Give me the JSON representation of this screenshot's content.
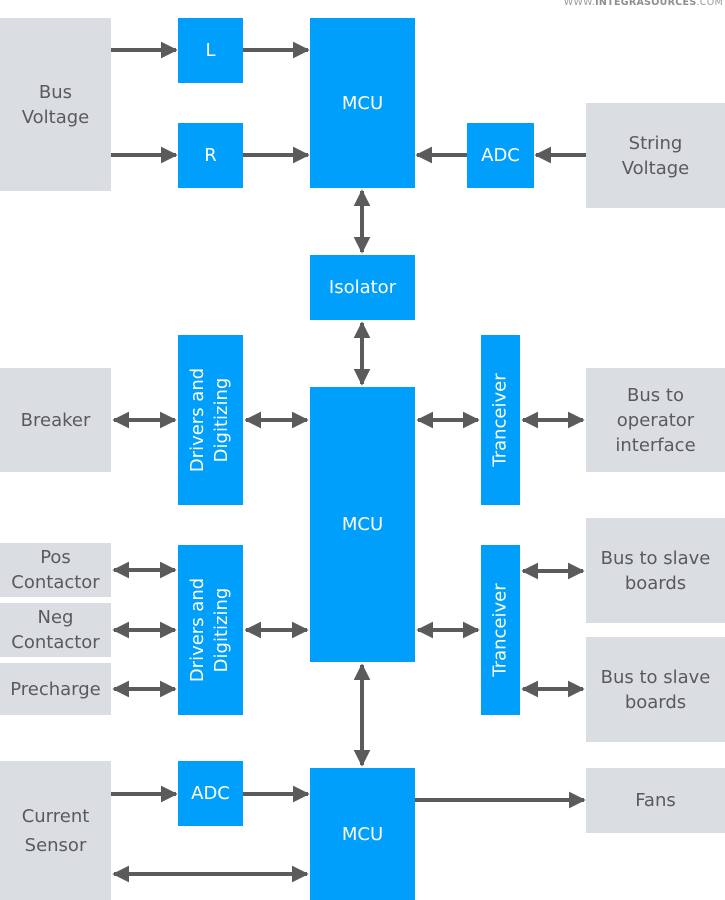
{
  "watermark": {
    "prefix": "WWW.",
    "brand": "INTEGRASOURCES",
    "suffix": ".COM"
  },
  "colors": {
    "block": "#009ffb",
    "external": "#dadde2",
    "arrow": "#5b5b5e",
    "external_text": "#5a5a5c"
  },
  "blocks": {
    "bus_voltage": "Bus\nVoltage",
    "l": "L",
    "r": "R",
    "mcu_top": "MCU",
    "adc_top": "ADC",
    "string_voltage": "String\nVoltage",
    "isolator": "Isolator",
    "breaker": "Breaker",
    "drivers_1": "Drivers and\nDigitizing",
    "mcu_main": "MCU",
    "tranceiver_1": "Tranceiver",
    "bus_operator": "Bus to\noperator\ninterface",
    "pos_contactor": "Pos\nContactor",
    "neg_contactor": "Neg\nContactor",
    "precharge": "Precharge",
    "drivers_2": "Drivers and\nDigitizing",
    "tranceiver_2": "Tranceiver",
    "bus_slave_1": "Bus to slave\nboards",
    "bus_slave_2": "Bus to slave\nboards",
    "current_sensor": "Current\nSensor",
    "adc_bottom": "ADC",
    "mcu_bottom": "MCU",
    "fans": "Fans"
  },
  "connections": [
    {
      "from": "Bus Voltage",
      "to": "L",
      "direction": "forward"
    },
    {
      "from": "Bus Voltage",
      "to": "R",
      "direction": "forward"
    },
    {
      "from": "L",
      "to": "MCU (top)",
      "direction": "forward"
    },
    {
      "from": "R",
      "to": "MCU (top)",
      "direction": "forward"
    },
    {
      "from": "String Voltage",
      "to": "ADC (top)",
      "direction": "forward"
    },
    {
      "from": "ADC (top)",
      "to": "MCU (top)",
      "direction": "forward"
    },
    {
      "from": "MCU (top)",
      "to": "Isolator",
      "direction": "bidirectional"
    },
    {
      "from": "Isolator",
      "to": "MCU (main)",
      "direction": "bidirectional"
    },
    {
      "from": "Breaker",
      "to": "Drivers and Digitizing (1)",
      "direction": "bidirectional"
    },
    {
      "from": "Drivers and Digitizing (1)",
      "to": "MCU (main)",
      "direction": "bidirectional"
    },
    {
      "from": "MCU (main)",
      "to": "Tranceiver (1)",
      "direction": "bidirectional"
    },
    {
      "from": "Tranceiver (1)",
      "to": "Bus to operator interface",
      "direction": "bidirectional"
    },
    {
      "from": "Pos Contactor",
      "to": "Drivers and Digitizing (2)",
      "direction": "bidirectional"
    },
    {
      "from": "Neg Contactor",
      "to": "Drivers and Digitizing (2)",
      "direction": "bidirectional"
    },
    {
      "from": "Precharge",
      "to": "Drivers and Digitizing (2)",
      "direction": "bidirectional"
    },
    {
      "from": "Drivers and Digitizing (2)",
      "to": "MCU (main)",
      "direction": "bidirectional"
    },
    {
      "from": "MCU (main)",
      "to": "Tranceiver (2)",
      "direction": "bidirectional"
    },
    {
      "from": "Tranceiver (2)",
      "to": "Bus to slave boards (1)",
      "direction": "bidirectional"
    },
    {
      "from": "Tranceiver (2)",
      "to": "Bus to slave boards (2)",
      "direction": "bidirectional"
    },
    {
      "from": "MCU (main)",
      "to": "MCU (bottom)",
      "direction": "bidirectional"
    },
    {
      "from": "Current Sensor",
      "to": "ADC (bottom)",
      "direction": "forward"
    },
    {
      "from": "ADC (bottom)",
      "to": "MCU (bottom)",
      "direction": "forward"
    },
    {
      "from": "Current Sensor",
      "to": "MCU (bottom)",
      "direction": "bidirectional"
    },
    {
      "from": "MCU (bottom)",
      "to": "Fans",
      "direction": "forward"
    }
  ]
}
